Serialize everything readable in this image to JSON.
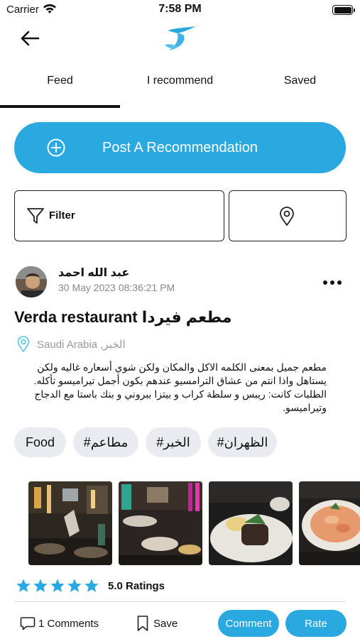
{
  "status_bar": {
    "carrier": "Carrier",
    "time": "7:58 PM"
  },
  "colors": {
    "accent": "#2aa9e0",
    "tag_bg": "#e9ebf1",
    "star": "#2aa9e0",
    "muted": "#999999"
  },
  "nav": {
    "back_icon": "arrow-left-icon",
    "logo_icon": "app-logo-icon"
  },
  "tabs": [
    {
      "label": "Feed",
      "active": true
    },
    {
      "label": "I recommend",
      "active": false
    },
    {
      "label": "Saved",
      "active": false
    }
  ],
  "post_button": {
    "label": "Post A Recommendation",
    "icon": "plus-circle-icon"
  },
  "filter": {
    "label": "Filter",
    "icon": "funnel-icon",
    "location_icon": "map-pin-icon"
  },
  "post": {
    "author": "عبد الله احمد",
    "date": "30 May 2023 08:36:21 PM",
    "title": "Verda restaurant مطعم فيردا",
    "location": "Saudi Arabia ,الخبر",
    "text": "مطعم جميل بمعنى الكلمه الاكل والمكان ولكن شوي أسعاره غاليه ولكن يستاهل واذا انتم من عشاق الترامسيو عندهم بكون أجمل تيراميسو تأكله. الطلبات كانت: ريبس و سلطة كراب و بيتزا ببروني و بنك باستا مع الدجاج وتيراميسو.",
    "tags": [
      "Food",
      "#مطاعم",
      "#الخبر",
      "#الظهران"
    ],
    "photos": [
      "restaurant-interior-photo",
      "restaurant-dining-photo",
      "ribs-dish-photo",
      "pink-pasta-photo"
    ],
    "rating": {
      "stars": 5,
      "label": "5.0 Ratings"
    }
  },
  "actions": {
    "comments": "1 Comments",
    "save": "Save",
    "comment_button": "Comment",
    "rate_button": "Rate"
  }
}
